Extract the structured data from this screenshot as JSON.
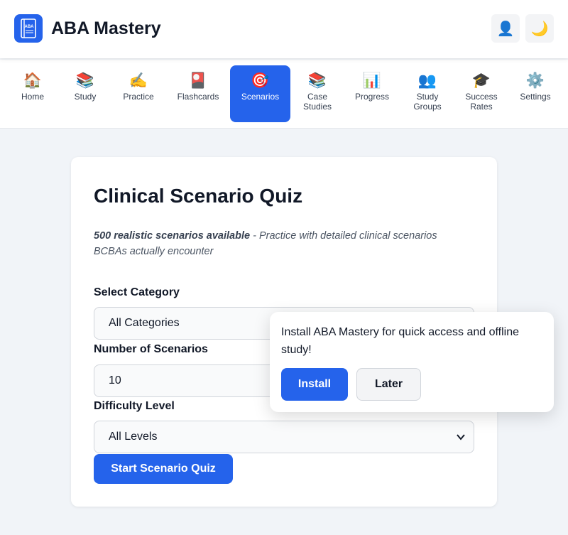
{
  "header": {
    "title": "ABA Mastery",
    "logo_text": "ABA",
    "user_icon": "user-icon",
    "theme_icon": "moon-icon"
  },
  "nav": {
    "items": [
      {
        "label": "Home",
        "icon": "🏠",
        "icon_name": "home-icon"
      },
      {
        "label": "Study",
        "icon": "📚",
        "icon_name": "books-icon"
      },
      {
        "label": "Practice",
        "icon": "✍️",
        "icon_name": "writing-hand-icon"
      },
      {
        "label": "Flashcards",
        "icon": "🎴",
        "icon_name": "flashcards-icon"
      },
      {
        "label": "Scenarios",
        "icon": "🎯",
        "icon_name": "target-icon",
        "active": true
      },
      {
        "label": "Case Studies",
        "icon": "📚",
        "icon_name": "books-icon"
      },
      {
        "label": "Progress",
        "icon": "📊",
        "icon_name": "bar-chart-icon"
      },
      {
        "label": "Study Groups",
        "icon": "👥",
        "icon_name": "people-icon"
      },
      {
        "label": "Success Rates",
        "icon": "🎓",
        "icon_name": "graduation-cap-icon"
      },
      {
        "label": "Settings",
        "icon": "⚙️",
        "icon_name": "gear-icon"
      }
    ]
  },
  "quiz": {
    "title": "Clinical Scenario Quiz",
    "intro_bold": "500 realistic scenarios available",
    "intro_rest": " - Practice with detailed clinical scenarios BCBAs actually encounter",
    "category_label": "Select Category",
    "category_value": "All Categories",
    "count_label": "Number of Scenarios",
    "count_value": "10",
    "difficulty_label": "Difficulty Level",
    "difficulty_value": "All Levels",
    "start_label": "Start Scenario Quiz"
  },
  "install_prompt": {
    "message": "Install ABA Mastery for quick access and offline study!",
    "install_label": "Install",
    "later_label": "Later"
  },
  "colors": {
    "accent": "#2563eb",
    "background": "#f1f4f8",
    "text": "#111827"
  }
}
